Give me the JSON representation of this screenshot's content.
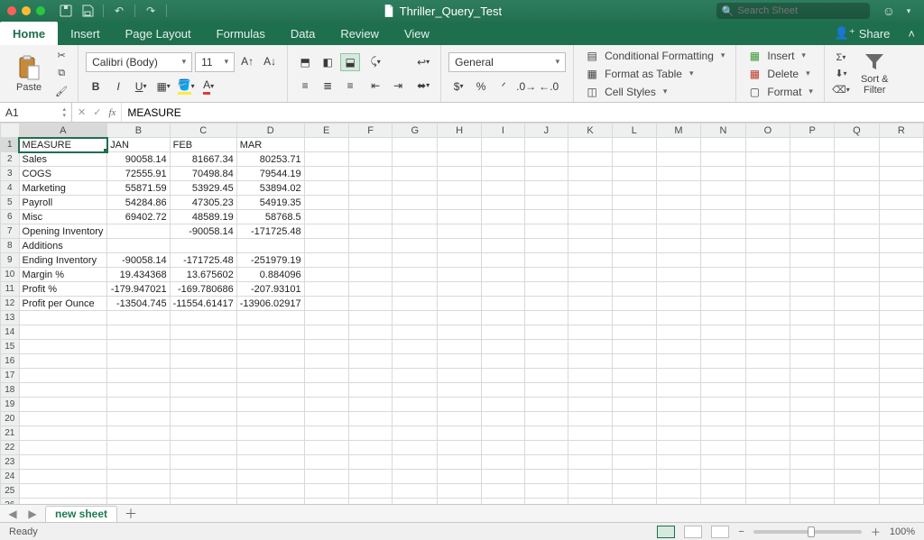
{
  "doc_title": "Thriller_Query_Test",
  "search_placeholder": "Search Sheet",
  "tabs": {
    "home": "Home",
    "insert": "Insert",
    "page_layout": "Page Layout",
    "formulas": "Formulas",
    "data": "Data",
    "review": "Review",
    "view": "View"
  },
  "share_label": "Share",
  "ribbon": {
    "paste": "Paste",
    "font_name": "Calibri (Body)",
    "font_size": "11",
    "number_format": "General",
    "cond_fmt": "Conditional Formatting",
    "fmt_table": "Format as Table",
    "cell_styles": "Cell Styles",
    "insert": "Insert",
    "delete": "Delete",
    "format": "Format",
    "sort_filter": "Sort &\nFilter"
  },
  "name_box": "A1",
  "formula_value": "MEASURE",
  "columns": [
    "A",
    "B",
    "C",
    "D",
    "E",
    "F",
    "G",
    "H",
    "I",
    "J",
    "K",
    "L",
    "M",
    "N",
    "O",
    "P",
    "Q",
    "R"
  ],
  "row_count": 28,
  "data_grid": {
    "1": {
      "A": "MEASURE",
      "B": "JAN",
      "C": "FEB",
      "D": "MAR"
    },
    "2": {
      "A": "Sales",
      "B": "90058.14",
      "C": "81667.34",
      "D": "80253.71"
    },
    "3": {
      "A": "COGS",
      "B": "72555.91",
      "C": "70498.84",
      "D": "79544.19"
    },
    "4": {
      "A": "Marketing",
      "B": "55871.59",
      "C": "53929.45",
      "D": "53894.02"
    },
    "5": {
      "A": "Payroll",
      "B": "54284.86",
      "C": "47305.23",
      "D": "54919.35"
    },
    "6": {
      "A": "Misc",
      "B": "69402.72",
      "C": "48589.19",
      "D": "58768.5"
    },
    "7": {
      "A": "Opening Inventory",
      "C": "-90058.14",
      "D": "-171725.48"
    },
    "8": {
      "A": "Additions"
    },
    "9": {
      "A": "Ending Inventory",
      "B": "-90058.14",
      "C": "-171725.48",
      "D": "-251979.19"
    },
    "10": {
      "A": "Margin %",
      "B": "19.434368",
      "C": "13.675602",
      "D": "0.884096"
    },
    "11": {
      "A": "Profit %",
      "B": "-179.947021",
      "C": "-169.780686",
      "D": "-207.93101"
    },
    "12": {
      "A": "Profit per Ounce",
      "B": "-13504.745",
      "C": "-11554.61417",
      "D": "-13906.02917"
    }
  },
  "sheet_tab": "new sheet",
  "status": "Ready",
  "zoom": "100%"
}
